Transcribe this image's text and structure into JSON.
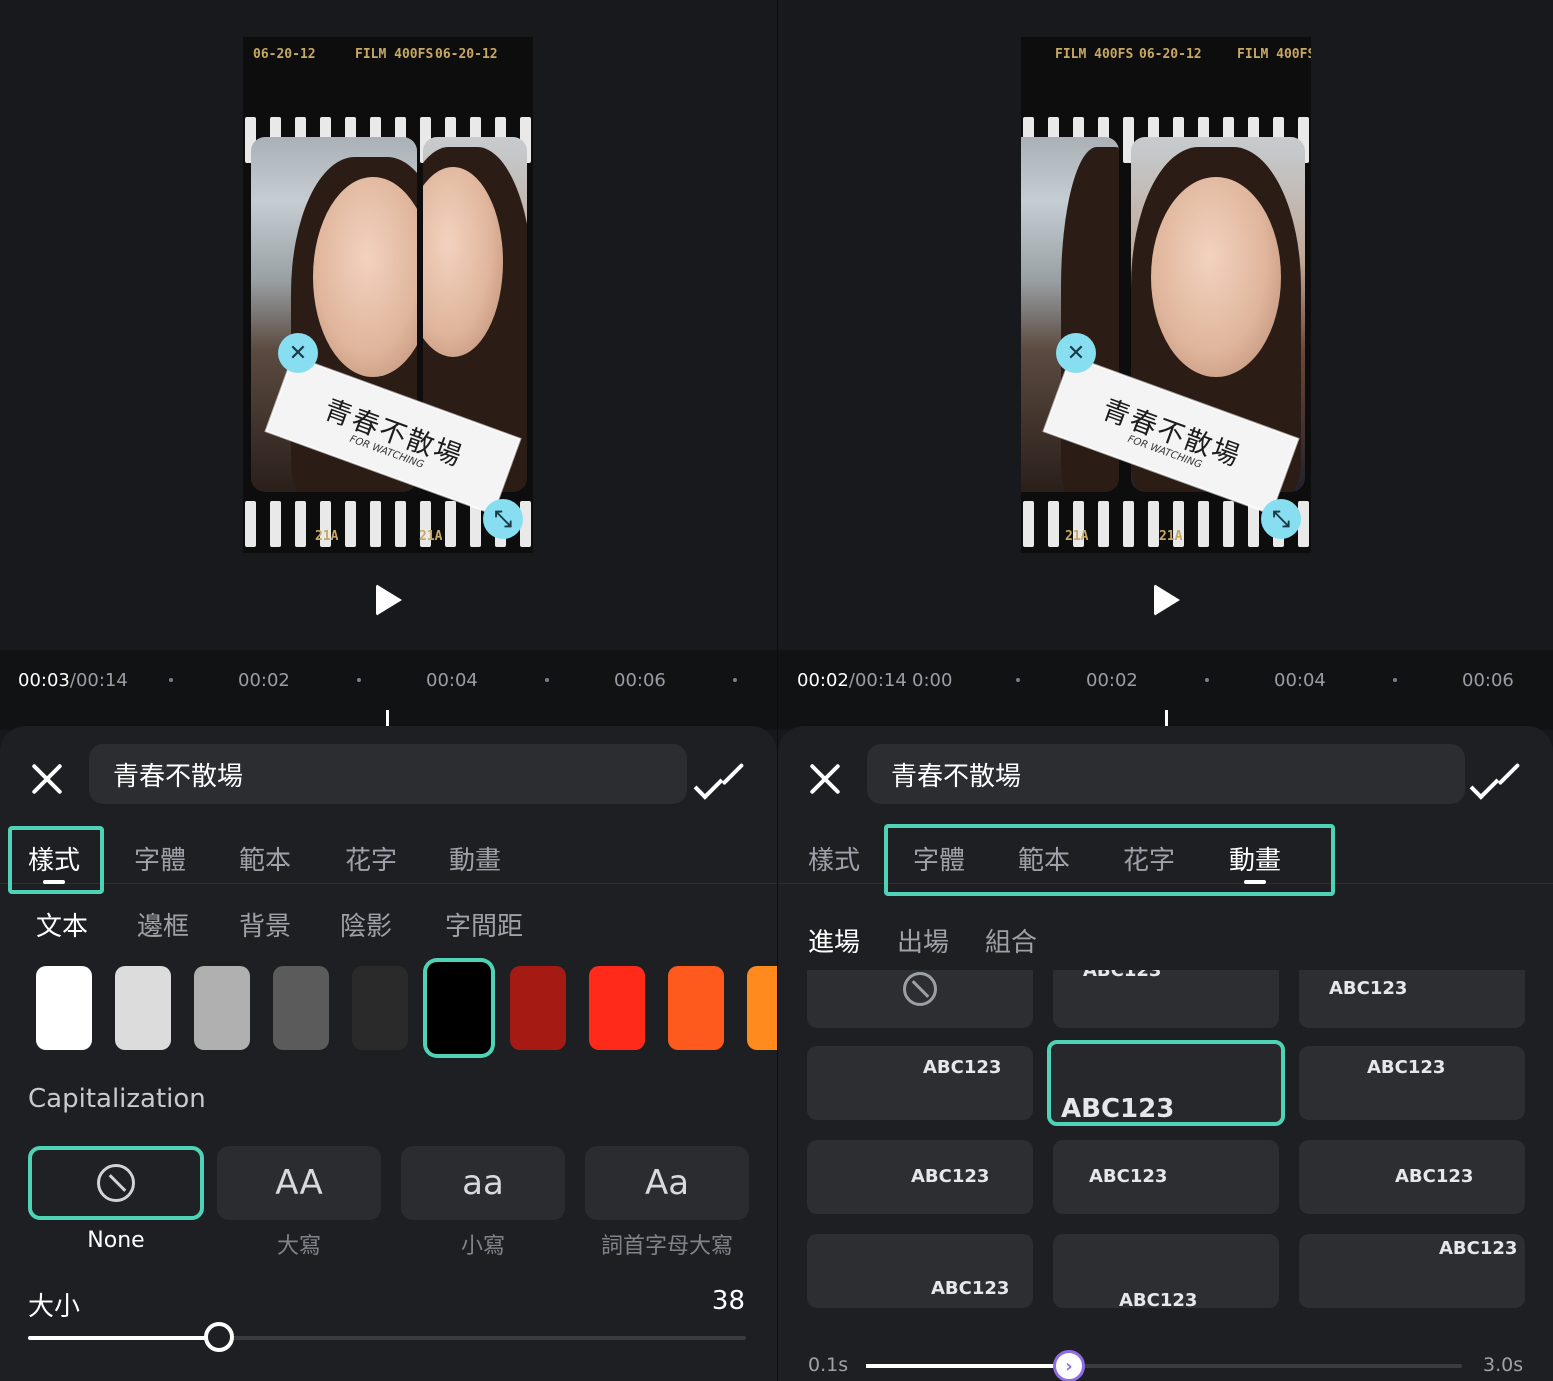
{
  "left": {
    "preview": {
      "film_top": [
        "06-20-12",
        "FILM 400FS",
        "06-20-12"
      ],
      "film_bottom": [
        "21A",
        "21A"
      ],
      "sticker_title": "青春不散場",
      "sticker_sub": "FOR WATCHING"
    },
    "timeline": {
      "current": "00:03",
      "total": "/00:14",
      "marks": [
        "00:02",
        "00:04",
        "00:06"
      ]
    },
    "editor": {
      "text_value": "青春不散場",
      "tabs": [
        "樣式",
        "字體",
        "範本",
        "花字",
        "動畫"
      ],
      "active_tab": "樣式",
      "subtabs": [
        "文本",
        "邊框",
        "背景",
        "陰影",
        "字間距"
      ],
      "swatches": [
        "#ffffff",
        "#dcdcdc",
        "#b0b0b0",
        "#5b5b5b",
        "#2a2a2a",
        "#000000",
        "#a51a12",
        "#ff2a1a",
        "#ff5a1e",
        "#ff8a1e"
      ],
      "selected_swatch": 5,
      "capitalization_label": "Capitalization",
      "cap_options": [
        {
          "glyph": "",
          "name": "None"
        },
        {
          "glyph": "AA",
          "name": "大寫"
        },
        {
          "glyph": "aa",
          "name": "小寫"
        },
        {
          "glyph": "Aa",
          "name": "詞首字母大寫"
        }
      ],
      "size_label": "大小",
      "size_value": "38",
      "size_fraction": 0.38
    }
  },
  "right": {
    "preview": {
      "film_top": [
        "FILM 400FS",
        "06-20-12",
        "FILM 400FS"
      ],
      "film_bottom": [
        "21A",
        "21A"
      ],
      "sticker_title": "青春不散場",
      "sticker_sub": "FOR WATCHING"
    },
    "timeline": {
      "current": "00:02",
      "total": "/00:14",
      "marks": [
        "0:00",
        "00:02",
        "00:04",
        "00:06"
      ]
    },
    "editor": {
      "text_value": "青春不散場",
      "tabs": [
        "樣式",
        "字體",
        "範本",
        "花字",
        "動畫"
      ],
      "active_tab": "動畫",
      "subtabs": [
        "進場",
        "出場",
        "組合"
      ],
      "animations": [
        "",
        "ABC123",
        "ABC123",
        "ABC123",
        "ABC123",
        "ABC123",
        "ABC123",
        "ABC123",
        "ABC123",
        "ABC123",
        "ABC123",
        "ABC123"
      ],
      "selected_animation": 4,
      "duration_min": "0.1s",
      "duration_max": "3.0s",
      "duration_fraction": 0.34
    }
  },
  "colors": {
    "accent": "#4fd3b6",
    "handle": "#86def0",
    "slider_knob_accent": "#8e6ce6"
  }
}
